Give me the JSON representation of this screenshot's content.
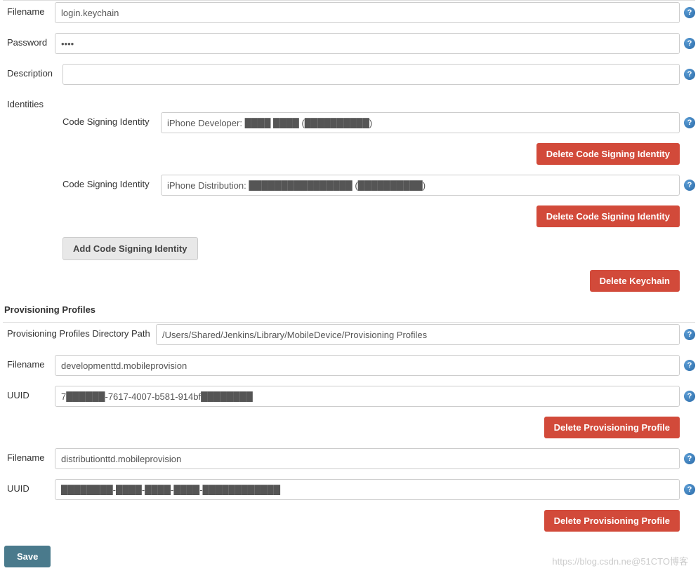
{
  "keychain": {
    "filename_label": "Filename",
    "filename_value": "login.keychain",
    "password_label": "Password",
    "password_value": "••••",
    "description_label": "Description",
    "description_value": "",
    "identities_label": "Identities",
    "identity_label": "Code Signing Identity",
    "identity1_value": "iPhone Developer: ████ ████ (██████████)",
    "identity2_value": "iPhone Distribution: ████████████████ (██████████)",
    "delete_identity_label": "Delete Code Signing Identity",
    "add_identity_label": "Add Code Signing Identity",
    "delete_keychain_label": "Delete Keychain"
  },
  "provisioning": {
    "section_title": "Provisioning Profiles",
    "dir_label": "Provisioning Profiles Directory Path",
    "dir_value": "/Users/Shared/Jenkins/Library/MobileDevice/Provisioning Profiles",
    "filename_label": "Filename",
    "uuid_label": "UUID",
    "profile1_filename": "developmenttd.mobileprovision",
    "profile1_uuid": "7██████-7617-4007-b581-914bf████████",
    "profile2_filename": "distributionttd.mobileprovision",
    "profile2_uuid": "████████-████-████-████-████████████",
    "delete_profile_label": "Delete Provisioning Profile"
  },
  "actions": {
    "save_label": "Save"
  },
  "watermark": "https://blog.csdn.ne@51CTO博客"
}
